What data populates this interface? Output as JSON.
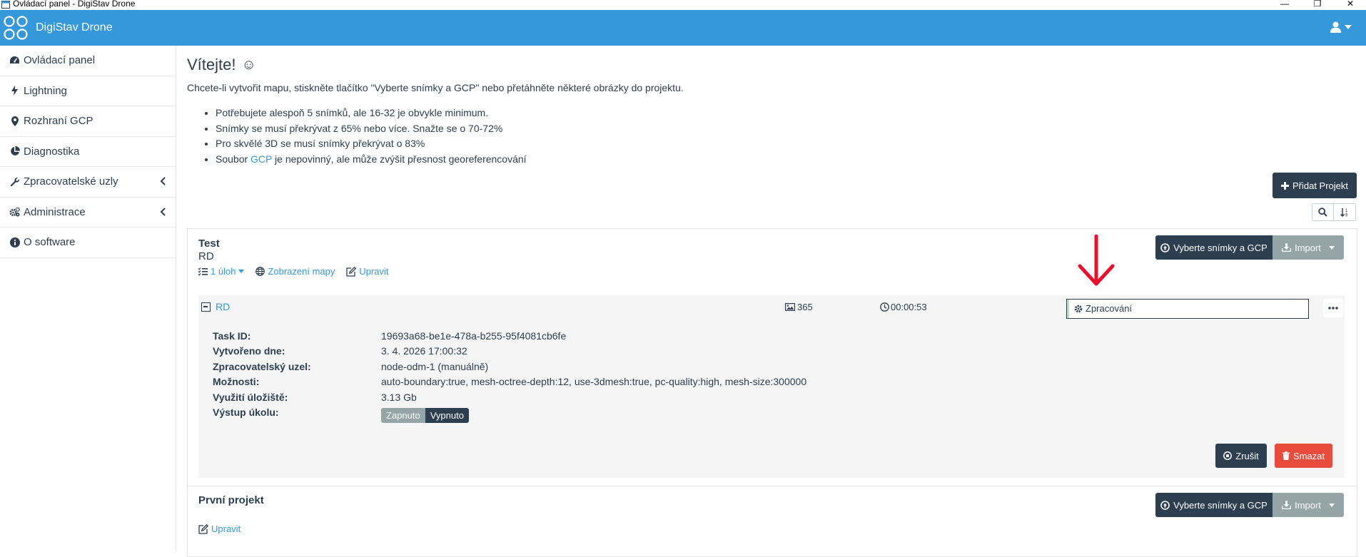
{
  "window": {
    "title": "Ovládací panel - DigiStav Drone",
    "minimize": "—",
    "maximize": "❐",
    "close": "✕"
  },
  "navbar": {
    "brand": "DigiStav Drone",
    "icons": [
      "drone-logo-icon",
      "user-icon",
      "caret-down-icon"
    ]
  },
  "sidebar": {
    "items": [
      {
        "label": "Ovládací panel",
        "icon": "dashboard-icon"
      },
      {
        "label": "Lightning",
        "icon": "bolt-icon"
      },
      {
        "label": "Rozhraní GCP",
        "icon": "map-marker-icon"
      },
      {
        "label": "Diagnostika",
        "icon": "pie-chart-icon"
      },
      {
        "label": "Zpracovatelské uzly",
        "icon": "wrench-icon",
        "expandable": true
      },
      {
        "label": "Administrace",
        "icon": "cogs-icon",
        "expandable": true
      },
      {
        "label": "O software",
        "icon": "info-icon"
      }
    ]
  },
  "main": {
    "welcome": "Vítejte!",
    "welcome_emoji": "☺",
    "intro": "Chcete-li vytvořit mapu, stiskněte tlačítko \"Vyberte snímky a GCP\" nebo přetáhněte některé obrázky do projektu.",
    "tips": [
      {
        "text": "Potřebujete alespoň 5 snímků, ale 16-32 je obvykle minimum."
      },
      {
        "text": "Snímky se musí překrývat z 65% nebo více. Snažte se o 70-72%"
      },
      {
        "text": "Pro skvělé 3D se musí snímky překrývat o 83%"
      },
      {
        "pre": "Soubor ",
        "link": "GCP",
        "post": " je nepovinný, ale může zvýšit přesnost georeferencování"
      }
    ],
    "add_project": "Přidat Projekt"
  },
  "projects": [
    {
      "name": "Test",
      "description": "RD",
      "select_button": "Vyberte snímky a GCP",
      "import_button": "Import",
      "links": {
        "tasks": "1 úloh",
        "map": "Zobrazení mapy",
        "edit": "Upravit"
      },
      "task": {
        "name": "RD",
        "images": "365",
        "duration": "00:00:53",
        "status": "Zpracování",
        "progress": 0.01,
        "details": [
          {
            "key": "Task ID:",
            "value": "19693a68-be1e-478a-b255-95f4081cb6fe"
          },
          {
            "key": "Vytvořeno dne:",
            "value": "3. 4. 2026 17:00:32"
          },
          {
            "key": "Zpracovatelský uzel:",
            "value": "node-odm-1 (manuálně)"
          },
          {
            "key": "Možnosti:",
            "value": "auto-boundary:true, mesh-octree-depth:12, use-3dmesh:true, pc-quality:high, mesh-size:300000"
          },
          {
            "key": "Využití úložiště:",
            "value": "3.13 Gb"
          },
          {
            "key": "Výstup úkolu:",
            "value": ""
          }
        ],
        "output_on": "Zapnuto",
        "output_off": "Vypnuto",
        "cancel": "Zrušit",
        "delete": "Smazat"
      }
    },
    {
      "name": "První projekt",
      "select_button": "Vyberte snímky a GCP",
      "import_button": "Import",
      "links": {
        "edit": "Upravit"
      }
    }
  ],
  "colors": {
    "primary": "#3498db",
    "dark": "#2c3e50",
    "gray": "#95a5a6",
    "danger": "#e74c3c",
    "annotation_arrow": "#e8112d"
  }
}
